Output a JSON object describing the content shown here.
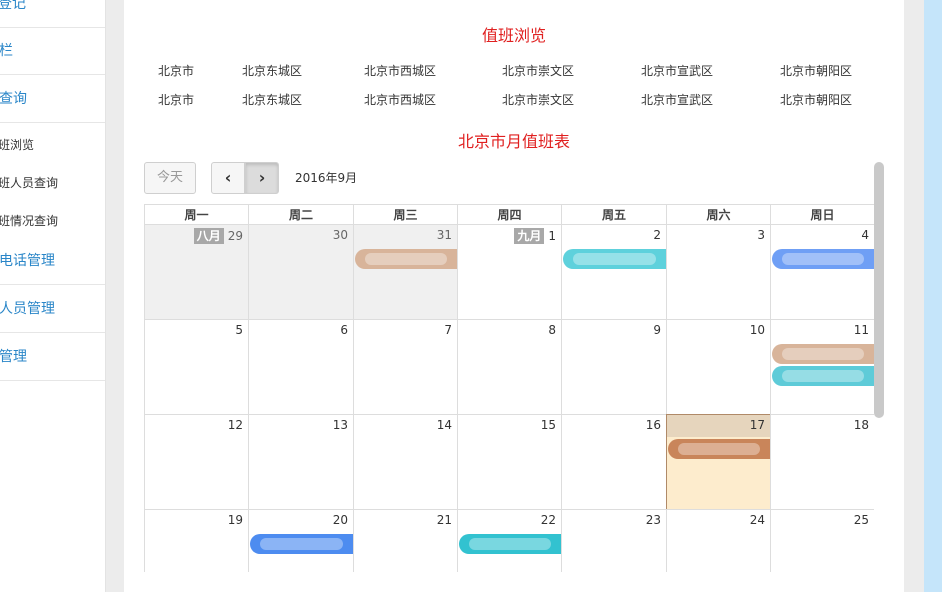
{
  "sidebar": {
    "items": [
      {
        "label": "登记",
        "type": "big"
      },
      {
        "label": "栏",
        "type": "big"
      },
      {
        "label": "查询",
        "type": "big"
      },
      {
        "label": "班浏览",
        "type": "sub"
      },
      {
        "label": "班人员查询",
        "type": "sub"
      },
      {
        "label": "班情况查询",
        "type": "sub"
      },
      {
        "label": "电话管理",
        "type": "big"
      },
      {
        "label": "人员管理",
        "type": "big"
      },
      {
        "label": "管理",
        "type": "big"
      }
    ]
  },
  "page": {
    "title": "值班浏览",
    "locations_row1": [
      "北京市",
      "北京东城区",
      "北京市西城区",
      "北京市崇文区",
      "北京市宣武区",
      "北京市朝阳区"
    ],
    "locations_row2": [
      "北京市",
      "北京东城区",
      "北京市西城区",
      "北京市崇文区",
      "北京市宣武区",
      "北京市朝阳区"
    ],
    "calendar_title": "北京市月值班表"
  },
  "toolbar": {
    "today_label": "今天",
    "prev_glyph": "‹",
    "next_glyph": "›",
    "month_label": "2016年9月"
  },
  "calendar": {
    "weekdays": [
      "周一",
      "周二",
      "周三",
      "周四",
      "周五",
      "周六",
      "周日"
    ],
    "weeks": [
      [
        {
          "d": "29",
          "badge": "八月",
          "other": true
        },
        {
          "d": "30",
          "other": true
        },
        {
          "d": "31",
          "other": true
        },
        {
          "d": "1",
          "badge": "九月"
        },
        {
          "d": "2"
        },
        {
          "d": "3"
        },
        {
          "d": "4"
        }
      ],
      [
        {
          "d": "5"
        },
        {
          "d": "6"
        },
        {
          "d": "7"
        },
        {
          "d": "8"
        },
        {
          "d": "9"
        },
        {
          "d": "10"
        },
        {
          "d": "11"
        }
      ],
      [
        {
          "d": "12"
        },
        {
          "d": "13"
        },
        {
          "d": "14"
        },
        {
          "d": "15"
        },
        {
          "d": "16"
        },
        {
          "d": "17",
          "today": true
        },
        {
          "d": "18"
        }
      ],
      [
        {
          "d": "19"
        },
        {
          "d": "20"
        },
        {
          "d": "21"
        },
        {
          "d": "22"
        },
        {
          "d": "23"
        },
        {
          "d": "24"
        },
        {
          "d": "25"
        }
      ]
    ],
    "events": [
      {
        "week": 0,
        "col": 2,
        "row": 0,
        "color": "#d8b49a"
      },
      {
        "week": 0,
        "col": 4,
        "row": 0,
        "color": "#5ed1dc"
      },
      {
        "week": 0,
        "col": 6,
        "row": 0,
        "color": "#6f9ff5"
      },
      {
        "week": 1,
        "col": 6,
        "row": 0,
        "color": "#d8b49a"
      },
      {
        "week": 1,
        "col": 6,
        "row": 1,
        "color": "#5ecbd8"
      },
      {
        "week": 2,
        "col": 5,
        "row": 0,
        "color": "#c9855a"
      },
      {
        "week": 3,
        "col": 1,
        "row": 0,
        "color": "#4d8cf0"
      },
      {
        "week": 3,
        "col": 3,
        "row": 0,
        "color": "#32c2d0"
      }
    ]
  },
  "colors": {
    "accent_red": "#e02020",
    "link_blue": "#2a86c8",
    "today_bg": "#fdeccd"
  }
}
